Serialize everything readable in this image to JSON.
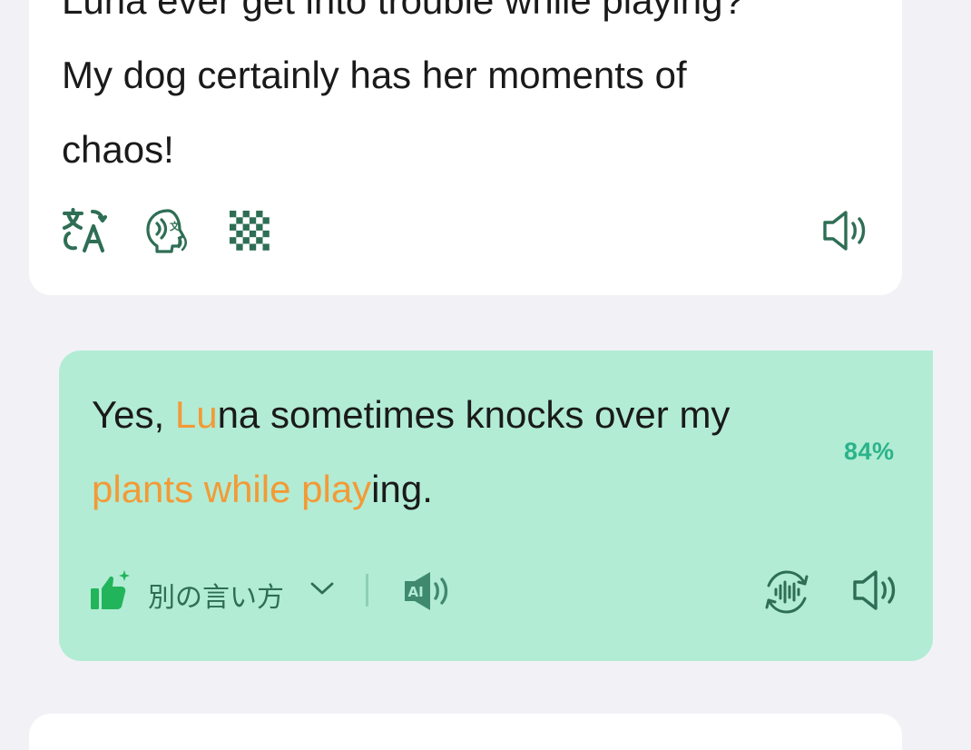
{
  "bot_message": {
    "lines": [
      "Luna ever get into trouble while playing?",
      "My dog certainly has her moments of",
      "chaos!"
    ],
    "icons": [
      "translate-icon",
      "pronunciation-icon",
      "mosaic-hide-icon",
      "speaker-icon"
    ]
  },
  "user_message": {
    "line1": {
      "pre": "Yes, ",
      "hl1": "Lu",
      "post": "na sometimes knocks over my"
    },
    "line2": {
      "hl": "plants while play",
      "post": "ing."
    },
    "score": "84%",
    "alt_phrasing_label": "別の言い方",
    "icons": [
      "thumbs-up-sparkle-icon",
      "chevron-down-icon",
      "ai-speaker-icon",
      "voice-replay-icon",
      "speaker-icon"
    ]
  },
  "colors": {
    "background": "#f2f2f6",
    "bot_card": "#ffffff",
    "user_bubble": "#b2ecd5",
    "highlight": "#f39a36",
    "icon_dark": "#2e6e55",
    "score": "#2bb38a",
    "thumbs_up": "#22b45a"
  }
}
